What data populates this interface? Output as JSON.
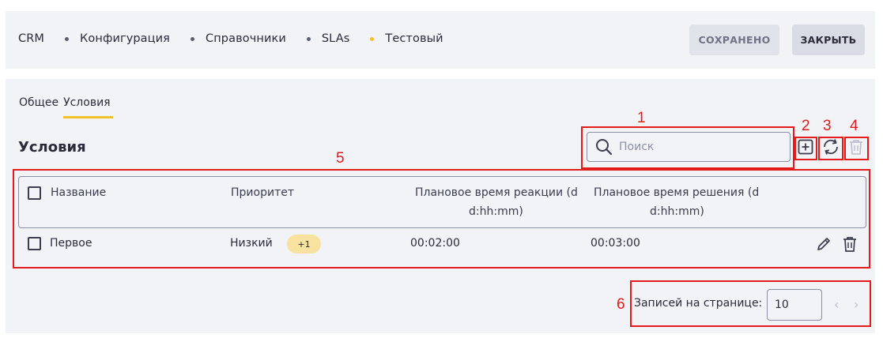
{
  "breadcrumbs": [
    "CRM",
    "Конфигурация",
    "Справочники",
    "SLAs",
    "Тестовый"
  ],
  "header": {
    "saved_label": "СОХРАНЕНО",
    "close_label": "ЗАКРЫТЬ"
  },
  "tabs": [
    "Общее",
    "Условия"
  ],
  "active_tab": "Условия",
  "section_title": "Условия",
  "search": {
    "placeholder": "Поиск"
  },
  "table": {
    "columns": [
      "Название",
      "Приоритет",
      "Плановое время реакции (d",
      "d:hh:mm)",
      "Плановое время решения (d",
      "d:hh:mm)"
    ],
    "rows": [
      {
        "name": "Первое",
        "priority": "Низкий",
        "priority_extra": "+1",
        "reaction": "00:02:00",
        "resolution": "00:03:00"
      }
    ]
  },
  "pagination": {
    "label": "Записей на странице:",
    "page_size": "10"
  },
  "annotations": [
    "1",
    "2",
    "3",
    "4",
    "5",
    "6"
  ],
  "colors": {
    "accent": "#f0bf2a",
    "annotation": "#e31b1b",
    "panel": "#f2f3f7"
  }
}
